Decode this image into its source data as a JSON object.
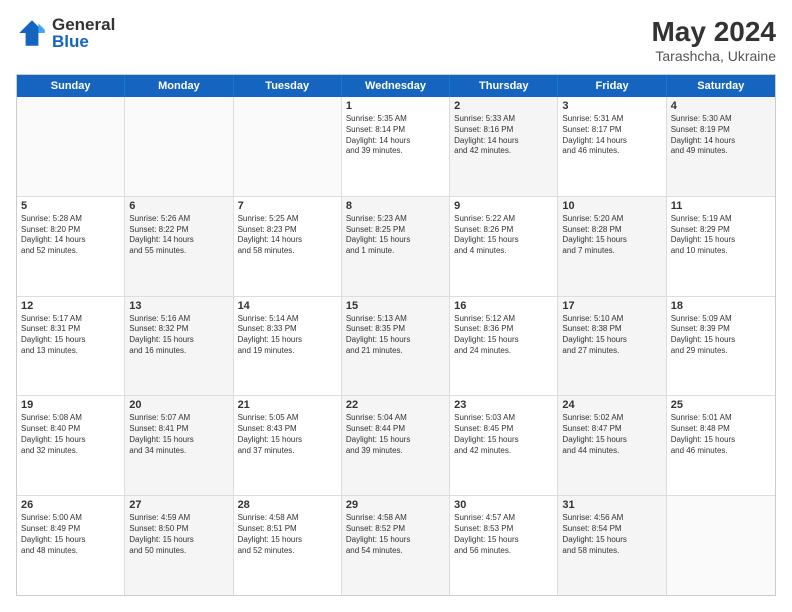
{
  "header": {
    "logo_general": "General",
    "logo_blue": "Blue",
    "month_year": "May 2024",
    "location": "Tarashcha, Ukraine"
  },
  "days_of_week": [
    "Sunday",
    "Monday",
    "Tuesday",
    "Wednesday",
    "Thursday",
    "Friday",
    "Saturday"
  ],
  "rows": [
    [
      {
        "day": "",
        "info": "",
        "shaded": false,
        "empty": true
      },
      {
        "day": "",
        "info": "",
        "shaded": false,
        "empty": true
      },
      {
        "day": "",
        "info": "",
        "shaded": false,
        "empty": true
      },
      {
        "day": "1",
        "info": "Sunrise: 5:35 AM\nSunset: 8:14 PM\nDaylight: 14 hours\nand 39 minutes.",
        "shaded": false,
        "empty": false
      },
      {
        "day": "2",
        "info": "Sunrise: 5:33 AM\nSunset: 8:16 PM\nDaylight: 14 hours\nand 42 minutes.",
        "shaded": true,
        "empty": false
      },
      {
        "day": "3",
        "info": "Sunrise: 5:31 AM\nSunset: 8:17 PM\nDaylight: 14 hours\nand 46 minutes.",
        "shaded": false,
        "empty": false
      },
      {
        "day": "4",
        "info": "Sunrise: 5:30 AM\nSunset: 8:19 PM\nDaylight: 14 hours\nand 49 minutes.",
        "shaded": true,
        "empty": false
      }
    ],
    [
      {
        "day": "5",
        "info": "Sunrise: 5:28 AM\nSunset: 8:20 PM\nDaylight: 14 hours\nand 52 minutes.",
        "shaded": false,
        "empty": false
      },
      {
        "day": "6",
        "info": "Sunrise: 5:26 AM\nSunset: 8:22 PM\nDaylight: 14 hours\nand 55 minutes.",
        "shaded": true,
        "empty": false
      },
      {
        "day": "7",
        "info": "Sunrise: 5:25 AM\nSunset: 8:23 PM\nDaylight: 14 hours\nand 58 minutes.",
        "shaded": false,
        "empty": false
      },
      {
        "day": "8",
        "info": "Sunrise: 5:23 AM\nSunset: 8:25 PM\nDaylight: 15 hours\nand 1 minute.",
        "shaded": true,
        "empty": false
      },
      {
        "day": "9",
        "info": "Sunrise: 5:22 AM\nSunset: 8:26 PM\nDaylight: 15 hours\nand 4 minutes.",
        "shaded": false,
        "empty": false
      },
      {
        "day": "10",
        "info": "Sunrise: 5:20 AM\nSunset: 8:28 PM\nDaylight: 15 hours\nand 7 minutes.",
        "shaded": true,
        "empty": false
      },
      {
        "day": "11",
        "info": "Sunrise: 5:19 AM\nSunset: 8:29 PM\nDaylight: 15 hours\nand 10 minutes.",
        "shaded": false,
        "empty": false
      }
    ],
    [
      {
        "day": "12",
        "info": "Sunrise: 5:17 AM\nSunset: 8:31 PM\nDaylight: 15 hours\nand 13 minutes.",
        "shaded": false,
        "empty": false
      },
      {
        "day": "13",
        "info": "Sunrise: 5:16 AM\nSunset: 8:32 PM\nDaylight: 15 hours\nand 16 minutes.",
        "shaded": true,
        "empty": false
      },
      {
        "day": "14",
        "info": "Sunrise: 5:14 AM\nSunset: 8:33 PM\nDaylight: 15 hours\nand 19 minutes.",
        "shaded": false,
        "empty": false
      },
      {
        "day": "15",
        "info": "Sunrise: 5:13 AM\nSunset: 8:35 PM\nDaylight: 15 hours\nand 21 minutes.",
        "shaded": true,
        "empty": false
      },
      {
        "day": "16",
        "info": "Sunrise: 5:12 AM\nSunset: 8:36 PM\nDaylight: 15 hours\nand 24 minutes.",
        "shaded": false,
        "empty": false
      },
      {
        "day": "17",
        "info": "Sunrise: 5:10 AM\nSunset: 8:38 PM\nDaylight: 15 hours\nand 27 minutes.",
        "shaded": true,
        "empty": false
      },
      {
        "day": "18",
        "info": "Sunrise: 5:09 AM\nSunset: 8:39 PM\nDaylight: 15 hours\nand 29 minutes.",
        "shaded": false,
        "empty": false
      }
    ],
    [
      {
        "day": "19",
        "info": "Sunrise: 5:08 AM\nSunset: 8:40 PM\nDaylight: 15 hours\nand 32 minutes.",
        "shaded": false,
        "empty": false
      },
      {
        "day": "20",
        "info": "Sunrise: 5:07 AM\nSunset: 8:41 PM\nDaylight: 15 hours\nand 34 minutes.",
        "shaded": true,
        "empty": false
      },
      {
        "day": "21",
        "info": "Sunrise: 5:05 AM\nSunset: 8:43 PM\nDaylight: 15 hours\nand 37 minutes.",
        "shaded": false,
        "empty": false
      },
      {
        "day": "22",
        "info": "Sunrise: 5:04 AM\nSunset: 8:44 PM\nDaylight: 15 hours\nand 39 minutes.",
        "shaded": true,
        "empty": false
      },
      {
        "day": "23",
        "info": "Sunrise: 5:03 AM\nSunset: 8:45 PM\nDaylight: 15 hours\nand 42 minutes.",
        "shaded": false,
        "empty": false
      },
      {
        "day": "24",
        "info": "Sunrise: 5:02 AM\nSunset: 8:47 PM\nDaylight: 15 hours\nand 44 minutes.",
        "shaded": true,
        "empty": false
      },
      {
        "day": "25",
        "info": "Sunrise: 5:01 AM\nSunset: 8:48 PM\nDaylight: 15 hours\nand 46 minutes.",
        "shaded": false,
        "empty": false
      }
    ],
    [
      {
        "day": "26",
        "info": "Sunrise: 5:00 AM\nSunset: 8:49 PM\nDaylight: 15 hours\nand 48 minutes.",
        "shaded": false,
        "empty": false
      },
      {
        "day": "27",
        "info": "Sunrise: 4:59 AM\nSunset: 8:50 PM\nDaylight: 15 hours\nand 50 minutes.",
        "shaded": true,
        "empty": false
      },
      {
        "day": "28",
        "info": "Sunrise: 4:58 AM\nSunset: 8:51 PM\nDaylight: 15 hours\nand 52 minutes.",
        "shaded": false,
        "empty": false
      },
      {
        "day": "29",
        "info": "Sunrise: 4:58 AM\nSunset: 8:52 PM\nDaylight: 15 hours\nand 54 minutes.",
        "shaded": true,
        "empty": false
      },
      {
        "day": "30",
        "info": "Sunrise: 4:57 AM\nSunset: 8:53 PM\nDaylight: 15 hours\nand 56 minutes.",
        "shaded": false,
        "empty": false
      },
      {
        "day": "31",
        "info": "Sunrise: 4:56 AM\nSunset: 8:54 PM\nDaylight: 15 hours\nand 58 minutes.",
        "shaded": true,
        "empty": false
      },
      {
        "day": "",
        "info": "",
        "shaded": false,
        "empty": true
      }
    ]
  ]
}
